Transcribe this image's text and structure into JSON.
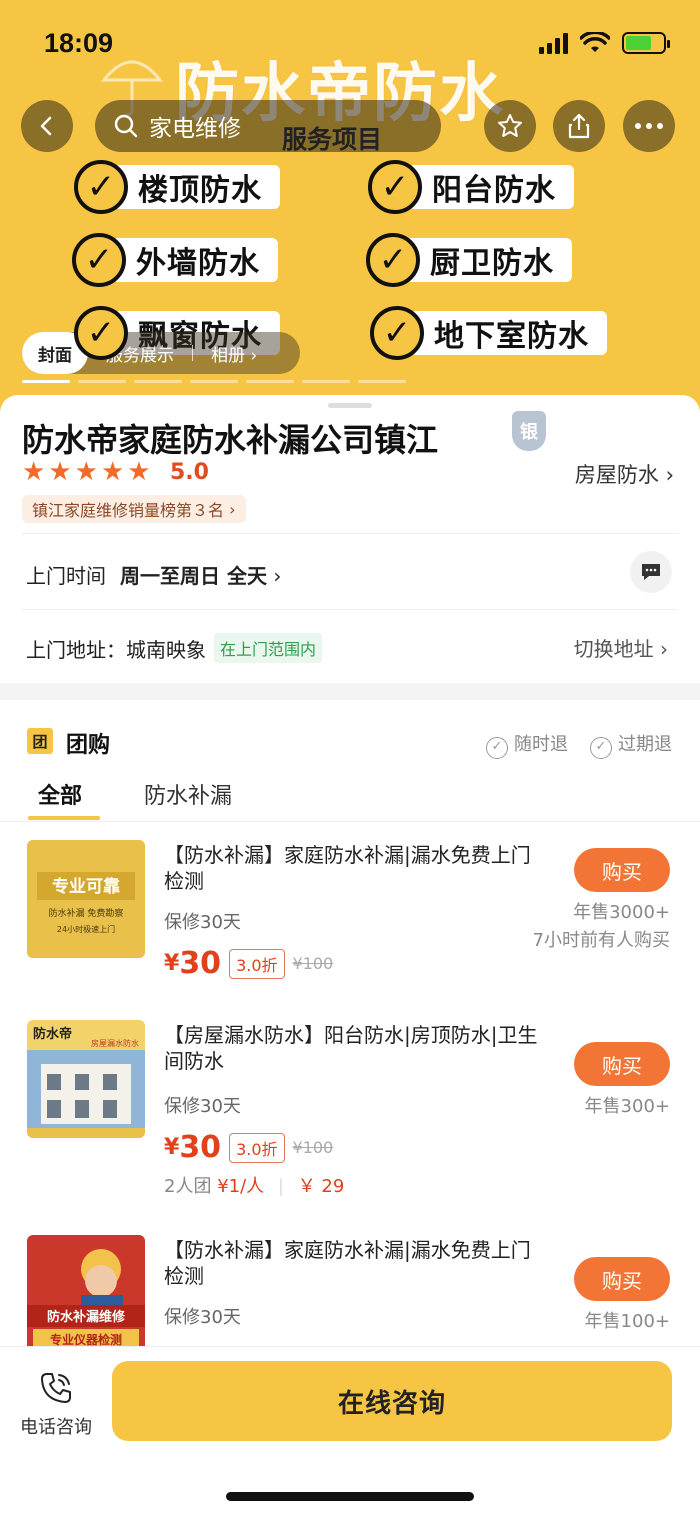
{
  "status": {
    "time": "18:09"
  },
  "hero": {
    "brand": "防水帝防水",
    "search_placeholder": "家电维修",
    "section_label": "服务项目",
    "services": [
      "楼顶防水",
      "阳台防水",
      "外墙防水",
      "厨卫防水",
      "飘窗防水",
      "地下室防水"
    ],
    "gallery_tabs": [
      "封面",
      "服务展示",
      "相册"
    ]
  },
  "shop": {
    "name": "防水帝家庭防水补漏公司镇江",
    "badge": "银",
    "rating": "5.0",
    "category": "房屋防水",
    "rank": "镇江家庭维修销量榜第３名",
    "hours_label": "上门时间",
    "hours_value": "周一至周日 全天",
    "address_label": "上门地址：城南映象",
    "address_tag": "在上门范围内",
    "switch_address": "切换地址"
  },
  "group": {
    "icon_text": "团",
    "title": "团购",
    "tags": [
      "随时退",
      "过期退"
    ],
    "tabs": [
      "全部",
      "防水补漏"
    ],
    "items": [
      {
        "title": "【防水补漏】家庭防水补漏|漏水免费上门检测",
        "warranty": "保修30天",
        "currency": "¥",
        "price": "30",
        "discount": "3.0折",
        "original": "¥100",
        "buy": "购买",
        "sales": "年售3000+",
        "recent": "7小时前有人购买",
        "thumb_text": [
          "专业可靠",
          "防水补漏 免费勘察",
          "24小时极速上门"
        ]
      },
      {
        "title": "【房屋漏水防水】阳台防水|房顶防水|卫生间防水",
        "warranty": "保修30天",
        "currency": "¥",
        "price": "30",
        "discount": "3.0折",
        "original": "¥100",
        "buy": "购买",
        "sales": "年售300+",
        "group_label": "2人团",
        "group_price": "¥1/人",
        "group_price2": "￥ 29",
        "thumb_text": [
          "防水帝",
          "房屋漏水防水"
        ]
      },
      {
        "title": "【防水补漏】家庭防水补漏|漏水免费上门检测",
        "warranty": "保修30天",
        "buy": "购买",
        "sales": "年售100+",
        "thumb_text": [
          "防水补漏维修",
          "专业仪器检测"
        ]
      }
    ]
  },
  "bottom": {
    "phone_label": "电话咨询",
    "online_label": "在线咨询"
  },
  "colors": {
    "accent": "#f6c544",
    "buy": "#f27535",
    "price": "#e2401a"
  }
}
